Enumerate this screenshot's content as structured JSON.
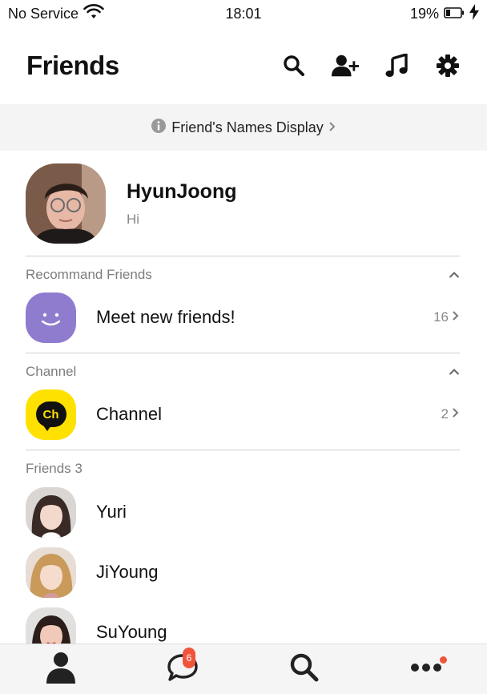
{
  "status_bar": {
    "carrier": "No Service",
    "time": "18:01",
    "battery": "19%"
  },
  "header": {
    "title": "Friends",
    "icons": [
      "search-icon",
      "add-friend-icon",
      "music-icon",
      "settings-icon"
    ]
  },
  "banner": {
    "text": "Friend's Names Display"
  },
  "profile": {
    "name": "HyunJoong",
    "status": "Hi"
  },
  "recommend": {
    "section_label": "Recommand Friends",
    "row_label": "Meet new friends!",
    "count": "16"
  },
  "channel": {
    "section_label": "Channel",
    "row_label": "Channel",
    "count": "2",
    "logo_text": "Ch"
  },
  "friends": {
    "section_label": "Friends 3",
    "items": [
      {
        "name": "Yuri"
      },
      {
        "name": "JiYoung"
      },
      {
        "name": "SuYoung"
      }
    ]
  },
  "tabbar": {
    "tabs": [
      "person-icon",
      "chat-icon",
      "search-icon",
      "more-icon"
    ],
    "chat_badge": "6"
  },
  "colors": {
    "accent_purple": "#8f7ccf",
    "channel_yellow": "#ffe100",
    "badge_red": "#f0553c"
  }
}
